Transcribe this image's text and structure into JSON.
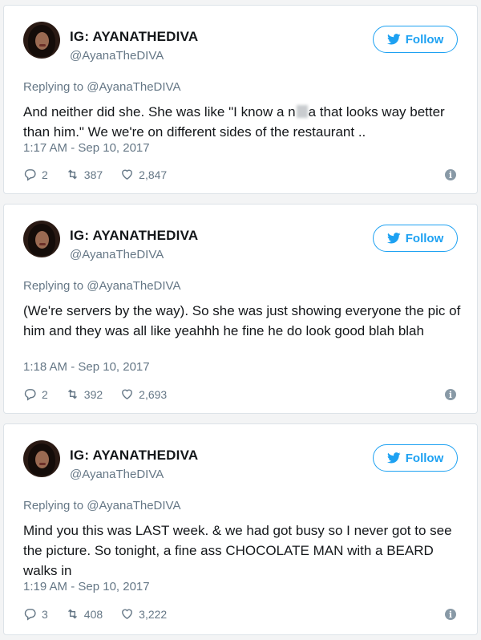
{
  "colors": {
    "accent": "#1da1f2",
    "muted": "#657786",
    "text": "#14171a"
  },
  "tweets": [
    {
      "name": "IG: AYANATHEDIVA",
      "handle": "@AyanaTheDIVA",
      "follow_label": "Follow",
      "replying_prefix": "Replying to ",
      "replying_mention": "@AyanaTheDIVA",
      "text_before_blur": "And neither did she. She was like \"I know a n",
      "text_after_blur": "a that looks way better than him.\" We we're on different sides of the restaurant ..",
      "timestamp": "1:17 AM - Sep 10, 2017",
      "replies": "2",
      "retweets": "387",
      "likes": "2,847"
    },
    {
      "name": "IG: AYANATHEDIVA",
      "handle": "@AyanaTheDIVA",
      "follow_label": "Follow",
      "replying_prefix": "Replying to ",
      "replying_mention": "@AyanaTheDIVA",
      "text": "(We're servers by the way). So she was just showing everyone the pic of him and they was all like yeahhh he fine he do look good blah blah",
      "timestamp": "1:18 AM - Sep 10, 2017",
      "replies": "2",
      "retweets": "392",
      "likes": "2,693"
    },
    {
      "name": "IG: AYANATHEDIVA",
      "handle": "@AyanaTheDIVA",
      "follow_label": "Follow",
      "replying_prefix": "Replying to ",
      "replying_mention": "@AyanaTheDIVA",
      "text": "Mind you this was LAST week. & we had got busy so I never got to see the picture. So tonight, a fine ass CHOCOLATE MAN with a BEARD walks in",
      "timestamp": "1:19 AM - Sep 10, 2017",
      "replies": "3",
      "retweets": "408",
      "likes": "3,222"
    }
  ],
  "icons": {
    "follow": "twitter-bird-icon",
    "reply": "reply-icon",
    "retweet": "retweet-icon",
    "like": "heart-icon",
    "info": "info-icon"
  }
}
